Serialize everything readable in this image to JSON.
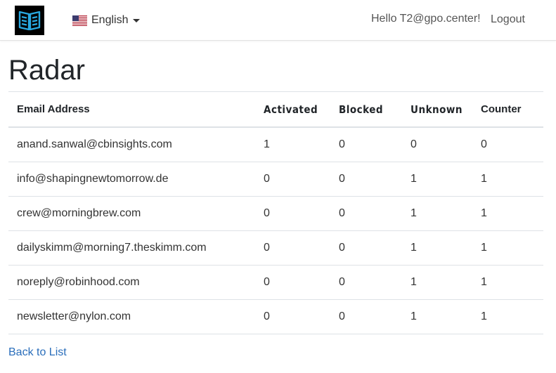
{
  "navbar": {
    "logo_icon": "book-logo-icon",
    "language": {
      "flag_icon": "us-flag-icon",
      "label": "English"
    },
    "greeting": "Hello T2@gpo.center!",
    "logout_label": "Logout"
  },
  "page": {
    "title": "Radar"
  },
  "table": {
    "headers": [
      "Email Address",
      "Activated",
      "Blocked",
      "Unknown",
      "Counter"
    ],
    "rows": [
      {
        "email": "anand.sanwal@cbinsights.com",
        "activated": "1",
        "blocked": "0",
        "unknown": "0",
        "counter": "0"
      },
      {
        "email": "info@shapingnewtomorrow.de",
        "activated": "0",
        "blocked": "0",
        "unknown": "1",
        "counter": "1"
      },
      {
        "email": "crew@morningbrew.com",
        "activated": "0",
        "blocked": "0",
        "unknown": "1",
        "counter": "1"
      },
      {
        "email": "dailyskimm@morning7.theskimm.com",
        "activated": "0",
        "blocked": "0",
        "unknown": "1",
        "counter": "1"
      },
      {
        "email": "noreply@robinhood.com",
        "activated": "0",
        "blocked": "0",
        "unknown": "1",
        "counter": "1"
      },
      {
        "email": "newsletter@nylon.com",
        "activated": "0",
        "blocked": "0",
        "unknown": "1",
        "counter": "1"
      }
    ]
  },
  "footer": {
    "back_label": "Back to List"
  },
  "colors": {
    "logo_bg": "#000000",
    "logo_accent": "#29a8e0",
    "link": "#2a6ebb"
  }
}
